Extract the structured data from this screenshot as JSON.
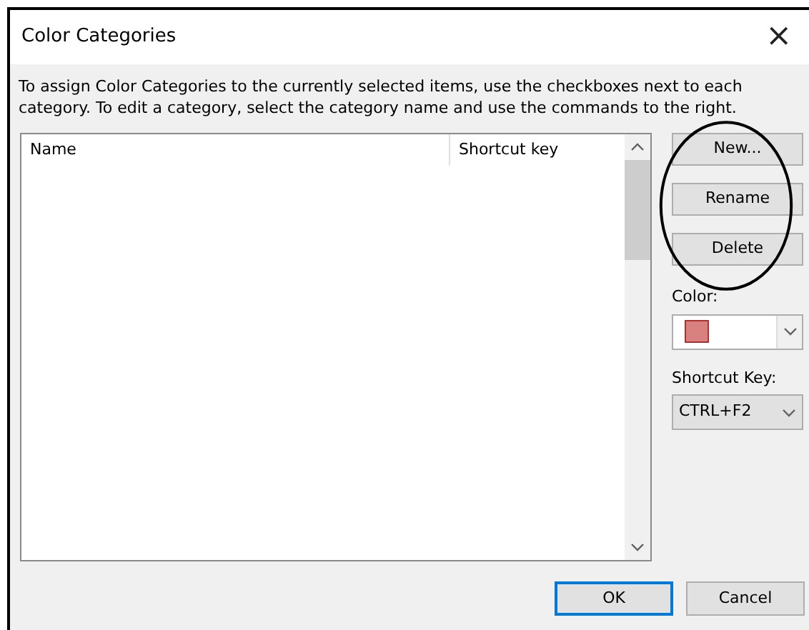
{
  "window": {
    "title": "Color Categories",
    "close": "×"
  },
  "description": "To assign Color Categories to the currently selected items, use the checkboxes next to each category.  To edit a category, select the category name and use the commands to the right.",
  "list": {
    "columns": [
      "Name",
      "Shortcut key"
    ]
  },
  "side_buttons": [
    {
      "label": "New..."
    },
    {
      "label": "Rename"
    },
    {
      "label": "Delete"
    }
  ],
  "color": {
    "label": "Color:",
    "color": "#d98080"
  },
  "shortcut": {
    "label": "Shortcut Key:",
    "value": "CTRL+F2"
  },
  "buttons": [
    {
      "label": "OK",
      "default": true
    },
    {
      "label": "Cancel",
      "default": false
    }
  ],
  "annotation": {
    "kind": "ellipse"
  }
}
